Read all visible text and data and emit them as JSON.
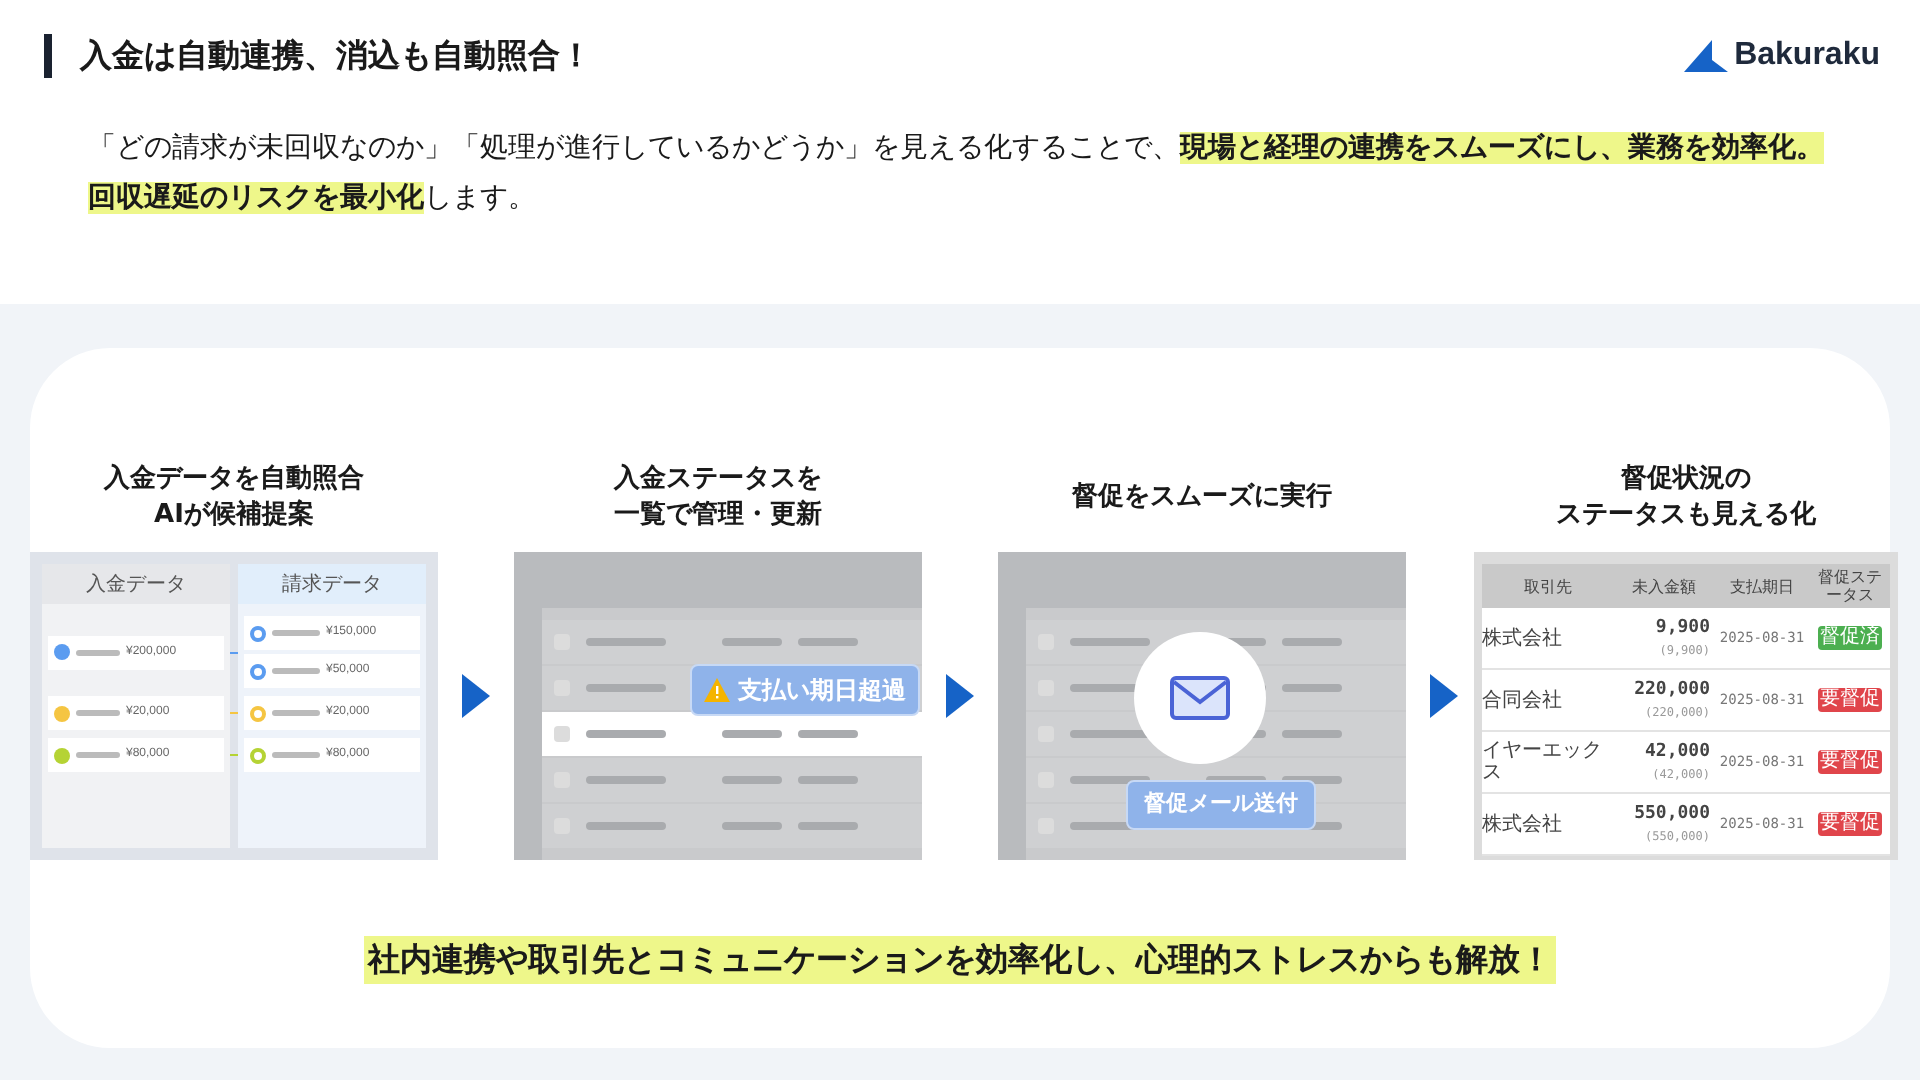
{
  "header": {
    "title": "入金は自動連携、消込も自動照合！",
    "logo": "Bakuraku"
  },
  "intro": "「どの請求が未回収なのか」「処理が進行しているかどうか」を見える化することで、**現場と経理の連携をスムーズにし、業務を効率化。回収遅延のリスクを最小化**します。",
  "steps": [
    {
      "title": [
        "入金データを自動照合",
        "AIが候補提案"
      ],
      "kind": "matching",
      "columns": [
        "入金データ",
        "請求データ"
      ],
      "groups": [
        {
          "amount": "¥200,000",
          "color": "#5b9cf0",
          "invoices": [
            "¥150,000",
            "¥50,000"
          ]
        },
        {
          "amount": "¥20,000",
          "color": "#f5c542",
          "invoices": [
            "¥20,000"
          ]
        },
        {
          "amount": "¥80,000",
          "color": "#b5d334",
          "invoices": [
            "¥80,000"
          ]
        }
      ]
    },
    {
      "title": [
        "入金ステータスを",
        "一覧で管理・更新"
      ],
      "kind": "status",
      "badge": "支払い期日超過"
    },
    {
      "title": [
        "督促をスムーズに実行"
      ],
      "kind": "reminder",
      "button": "督促メール送付"
    },
    {
      "title": [
        "督促状況の",
        "ステータスも見える化"
      ],
      "kind": "table",
      "columns": [
        "取引先",
        "未入金額",
        "支払期日",
        "督促ステータス"
      ],
      "rows": [
        {
          "name": "株式会社",
          "amount": "9,900",
          "subamount": "(9,900)",
          "due": "2025-08-31",
          "status": "督促済",
          "done": true
        },
        {
          "name": "合同会社",
          "amount": "220,000",
          "subamount": "(220,000)",
          "due": "2025-08-31",
          "status": "要督促",
          "done": false
        },
        {
          "name": "イヤーエックス",
          "amount": "42,000",
          "subamount": "(42,000)",
          "due": "2025-08-31",
          "status": "要督促",
          "done": false
        },
        {
          "name": "株式会社",
          "amount": "550,000",
          "subamount": "(550,000)",
          "due": "2025-08-31",
          "status": "要督促",
          "done": false
        }
      ]
    }
  ],
  "footer": "社内連携や取引先とコミュニケーションを効率化し、心理的ストレスからも解放！"
}
